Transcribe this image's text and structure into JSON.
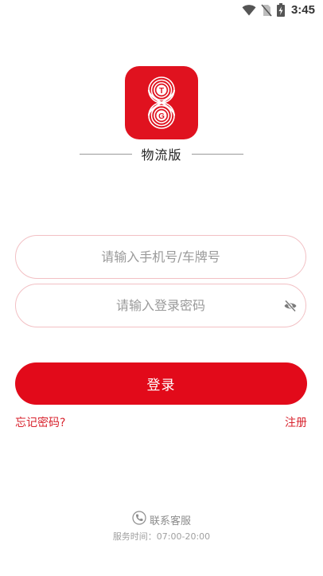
{
  "status_bar": {
    "time": "3:45",
    "icons": [
      "wifi-icon",
      "no-sim-icon",
      "battery-charging-icon"
    ]
  },
  "brand": {
    "logo_icon": "tg-logo-icon",
    "logo_letters": [
      "T",
      "G"
    ],
    "subtitle": "物流版",
    "accent_color": "#e0121f"
  },
  "form": {
    "phone_placeholder": "请输入手机号/车牌号",
    "phone_value": "",
    "password_placeholder": "请输入登录密码",
    "password_value": "",
    "password_toggle_icon": "eye-off-icon",
    "login_label": "登录",
    "forgot_label": "忘记密码?",
    "register_label": "注册"
  },
  "footer": {
    "support_icon": "phone-icon",
    "support_label": "联系客服",
    "hours_label": "服务时间：07:00-20:00"
  }
}
